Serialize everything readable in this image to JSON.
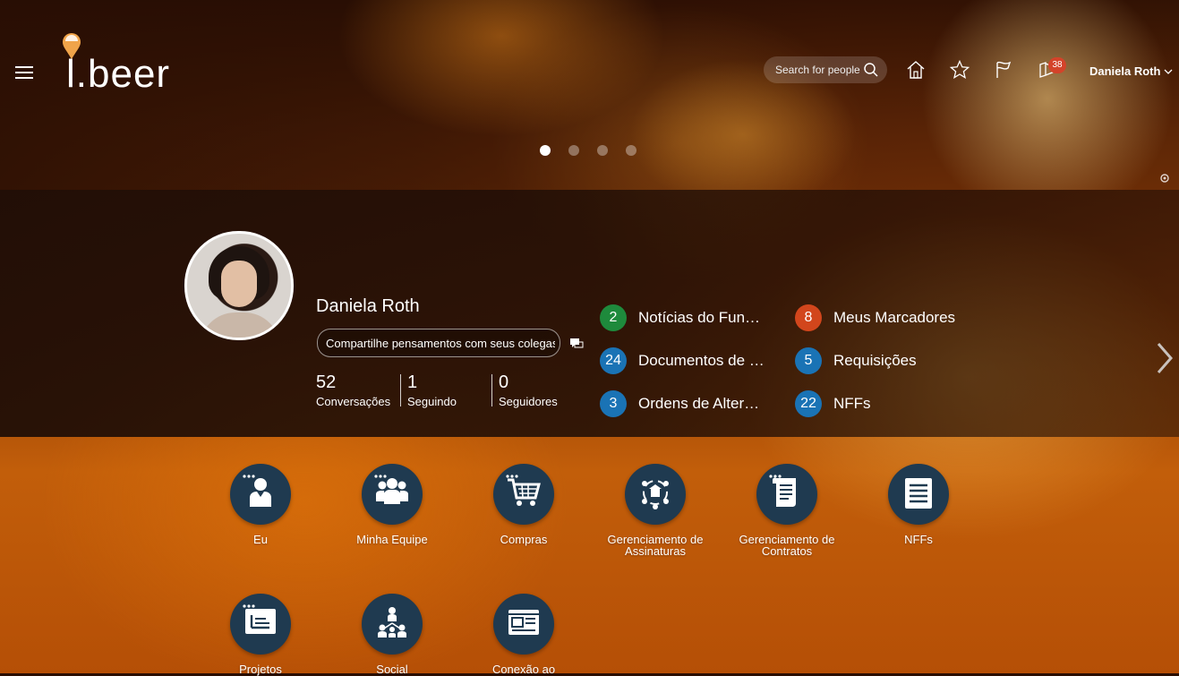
{
  "header": {
    "logo_text": "l.beer",
    "search_placeholder": "Search for people",
    "notification_count": "38",
    "user_name": "Daniela Roth"
  },
  "carousel": {
    "slides": 4,
    "active": 1
  },
  "profile": {
    "name": "Daniela Roth",
    "share_placeholder": "Compartilhe pensamentos com seus colegas",
    "stats": [
      {
        "value": "52",
        "label": "Conversações"
      },
      {
        "value": "1",
        "label": "Seguindo"
      },
      {
        "value": "0",
        "label": "Seguidores"
      }
    ]
  },
  "worklists": [
    {
      "count": "2",
      "label": "Notícias do Fun…",
      "color": "#1e8a3c"
    },
    {
      "count": "24",
      "label": "Documentos de …",
      "color": "#1a73b5"
    },
    {
      "count": "3",
      "label": "Ordens de Alter…",
      "color": "#1a73b5"
    },
    {
      "count": "8",
      "label": "Meus Marcadores",
      "color": "#d2461c"
    },
    {
      "count": "5",
      "label": "Requisições",
      "color": "#1a73b5"
    },
    {
      "count": "22",
      "label": "NFFs",
      "color": "#1a73b5"
    }
  ],
  "apps": [
    {
      "label1": "Eu",
      "label2": "",
      "icon": "person-icon"
    },
    {
      "label1": "Minha Equipe",
      "label2": "",
      "icon": "team-icon"
    },
    {
      "label1": "Compras",
      "label2": "",
      "icon": "cart-icon"
    },
    {
      "label1": "Gerenciamento de",
      "label2": "Assinaturas",
      "icon": "subscriptions-icon"
    },
    {
      "label1": "Gerenciamento de",
      "label2": "Contratos",
      "icon": "contract-icon"
    },
    {
      "label1": "NFFs",
      "label2": "",
      "icon": "document-list-icon"
    },
    {
      "label1": "Projetos",
      "label2": "",
      "icon": "projects-icon"
    },
    {
      "label1": "Social",
      "label2": "",
      "icon": "social-icon"
    },
    {
      "label1": "Conexão ao",
      "label2": "",
      "icon": "connection-icon"
    }
  ]
}
